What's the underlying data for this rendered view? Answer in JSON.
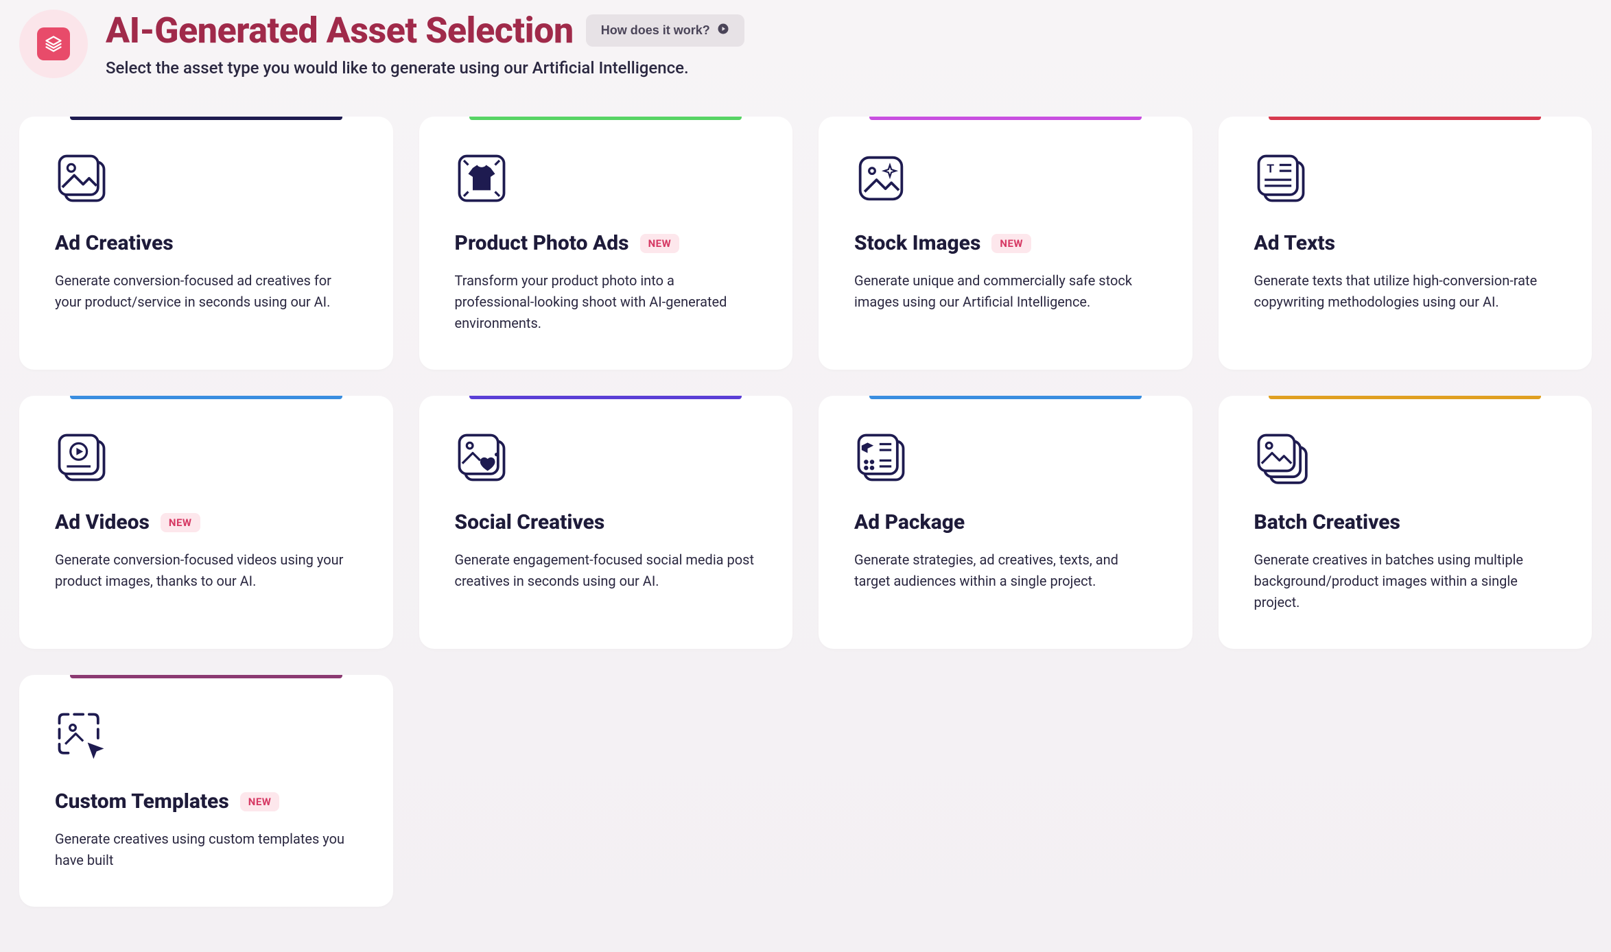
{
  "header": {
    "title": "AI-Generated Asset Selection",
    "subtitle": "Select the asset type you would like to generate using our Artificial Intelligence.",
    "how_label": "How does it work?"
  },
  "badges": {
    "new": "NEW"
  },
  "cards": [
    {
      "id": "ad-creatives",
      "title": "Ad Creatives",
      "desc": "Generate conversion-focused ad creatives for your product/service in seconds using our AI.",
      "accent": "#1e1b50",
      "new": false,
      "icon": "image-stack"
    },
    {
      "id": "product-photo-ads",
      "title": "Product Photo Ads",
      "desc": "Transform your product photo into a professional-looking shoot with AI-generated environments.",
      "accent": "#57d465",
      "new": true,
      "icon": "tshirt-frame"
    },
    {
      "id": "stock-images",
      "title": "Stock Images",
      "desc": "Generate unique and commercially safe stock images using our Artificial Intelligence.",
      "accent": "#c84fe0",
      "new": true,
      "icon": "image-sparkle"
    },
    {
      "id": "ad-texts",
      "title": "Ad Texts",
      "desc": "Generate texts that utilize high-conversion-rate copywriting methodologies using our AI.",
      "accent": "#d73a4f",
      "new": false,
      "icon": "text-doc"
    },
    {
      "id": "ad-videos",
      "title": "Ad Videos",
      "desc": "Generate conversion-focused videos using your product images, thanks to our AI.",
      "accent": "#3a8ee0",
      "new": true,
      "icon": "video-play"
    },
    {
      "id": "social-creatives",
      "title": "Social Creatives",
      "desc": "Generate engagement-focused social media post creatives in seconds using our AI.",
      "accent": "#5b3fd6",
      "new": false,
      "icon": "image-heart"
    },
    {
      "id": "ad-package",
      "title": "Ad Package",
      "desc": "Generate strategies, ad creatives, texts, and target audiences within a single project.",
      "accent": "#3a8ee0",
      "new": false,
      "icon": "package-grid"
    },
    {
      "id": "batch-creatives",
      "title": "Batch Creatives",
      "desc": "Generate creatives in batches using multiple background/product images within a single project.",
      "accent": "#e0a021",
      "new": false,
      "icon": "batch-stack"
    },
    {
      "id": "custom-templates",
      "title": "Custom Templates",
      "desc": "Generate creatives using custom templates you have built",
      "accent": "#8b3a72",
      "new": true,
      "icon": "template-cursor"
    }
  ]
}
